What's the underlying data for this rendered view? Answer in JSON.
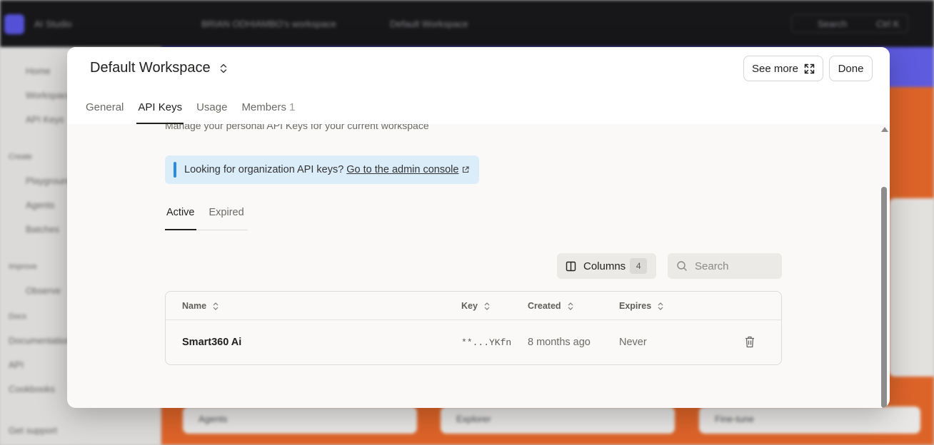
{
  "background": {
    "app_name": "AI Studio",
    "breadcrumb_org": "BRIAN ODHIAMBO's workspace",
    "breadcrumb_workspace": "Default Workspace",
    "search_label": "Search",
    "shortcut": "Ctrl K",
    "sidebar_items": [
      "Home",
      "Workspaces",
      "API Keys",
      "Create",
      "Playground",
      "Agents",
      "Batches",
      "Improve",
      "Observe",
      "Docs",
      "Documentation",
      "API",
      "Cookbooks",
      "Get support"
    ],
    "cards": [
      "Agents",
      "Explorer",
      "Fine-tune"
    ]
  },
  "modal": {
    "title": "Default Workspace",
    "see_more_label": "See more",
    "done_label": "Done",
    "tabs": [
      {
        "label": "General"
      },
      {
        "label": "API Keys",
        "active": true
      },
      {
        "label": "Usage"
      },
      {
        "label": "Members",
        "count": "1"
      }
    ],
    "subtitle": "Manage your personal API Keys for your current workspace",
    "notice": {
      "text": "Looking for organization API keys?",
      "link": "Go to the admin console"
    },
    "subtabs": [
      {
        "label": "Active",
        "active": true
      },
      {
        "label": "Expired"
      }
    ],
    "columns_label": "Columns",
    "columns_count": "4",
    "search_placeholder": "Search",
    "table": {
      "headers": [
        "Name",
        "Key",
        "Created",
        "Expires"
      ],
      "rows": [
        {
          "name": "Smart360 Ai",
          "key": "**...YKfn",
          "created": "8 months ago",
          "expires": "Never"
        }
      ]
    }
  },
  "colors": {
    "notice_bg": "#dcedfa",
    "notice_accent": "#2a8be0",
    "modal_bg": "#faf9f7",
    "brand_orange": "#ee6b2b",
    "brand_purple": "#6461f0"
  },
  "icons": {
    "title_switcher": "chevron-up-down-icon",
    "see_more": "expand-icon",
    "notice_link": "external-link-icon",
    "columns": "columns-icon",
    "search": "search-icon",
    "sort": "sort-icon",
    "delete": "trash-icon"
  }
}
